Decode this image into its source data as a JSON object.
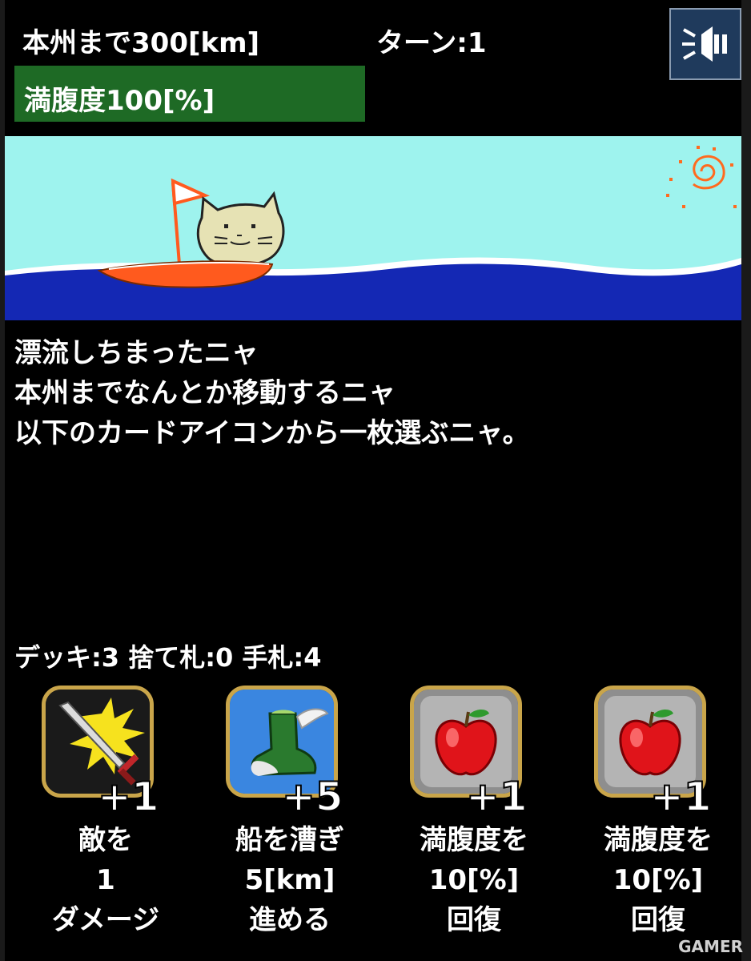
{
  "hud": {
    "distance_text": "本州まで300[km]",
    "turn_text": "ターン:1",
    "hunger_text": "満腹度100[%]",
    "hunger_percent": 100,
    "sound_button_icon": "speaker-icon"
  },
  "message": {
    "lines": [
      "漂流しちまったニャ",
      "本州までなんとか移動するニャ",
      "以下のカードアイコンから一枚選ぶニャ。"
    ]
  },
  "deck": {
    "status_text": "デッキ:3 捨て札:0 手札:4"
  },
  "cards": [
    {
      "icon": "sword-icon",
      "bonus": "+1",
      "desc": [
        "敵を",
        "1",
        "ダメージ"
      ]
    },
    {
      "icon": "winged-boot-icon",
      "bonus": "+5",
      "desc": [
        "船を漕ぎ",
        "5[km]",
        "進める"
      ]
    },
    {
      "icon": "apple-icon",
      "bonus": "+1",
      "desc": [
        "満腹度を",
        "10[%]",
        "回復"
      ]
    },
    {
      "icon": "apple-icon",
      "bonus": "+1",
      "desc": [
        "満腹度を",
        "10[%]",
        "回復"
      ]
    }
  ],
  "watermark": "GAMER",
  "colors": {
    "sky": "#9ef3ee",
    "sea": "#1428b4",
    "boat": "#ff5a1e",
    "hunger_bar": "#1e6a25",
    "card_border": "#c9a54a"
  }
}
